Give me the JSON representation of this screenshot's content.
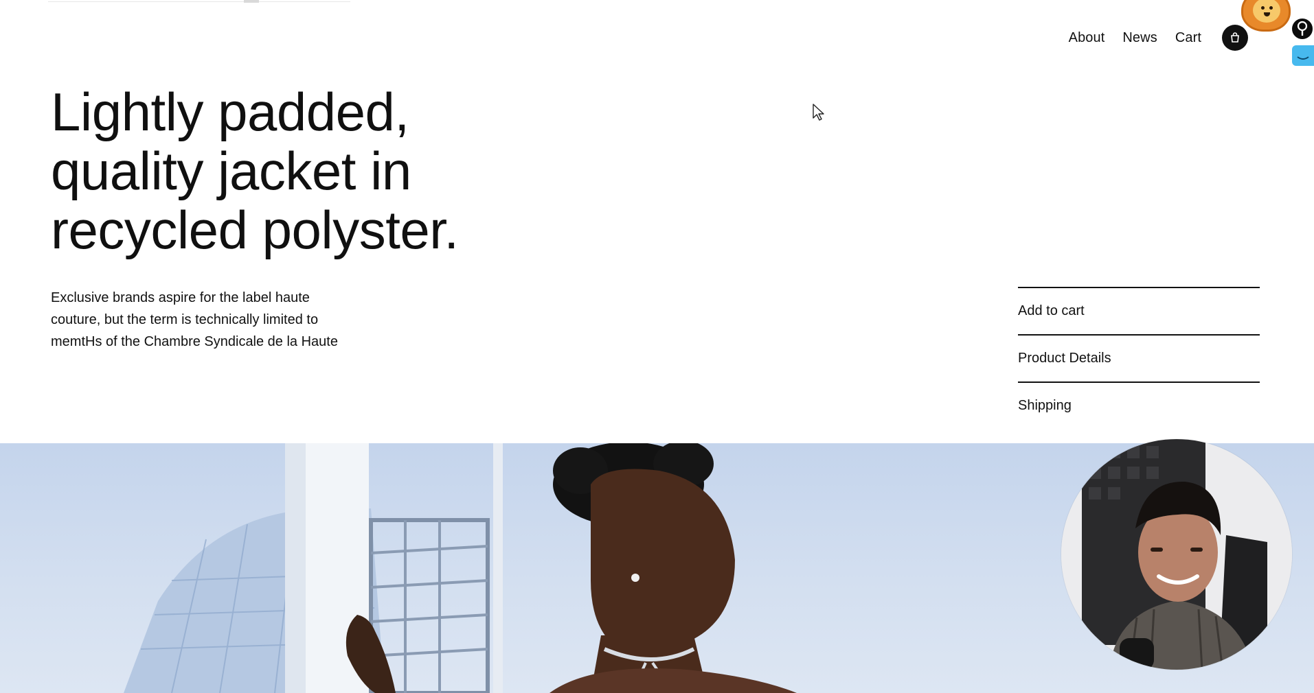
{
  "nav": {
    "items": [
      "About",
      "News",
      "Cart"
    ],
    "cart_icon": "shopping-bag-icon"
  },
  "hero": {
    "headline_lines": [
      "Lightly padded,",
      "quality jacket in",
      "recycled polyster."
    ],
    "description_lines": [
      "Exclusive brands aspire for the label haute",
      "couture, but the term is technically limited to",
      "memtHs of the Chambre Syndicale de la Haute"
    ]
  },
  "accordion": {
    "items": [
      "Add to cart",
      "Product Details",
      "Shipping"
    ]
  },
  "overlays": {
    "mascot_icon": "lion-mascot-icon",
    "key_icon": "key-icon",
    "side_tab_icon": "extension-tab-icon",
    "cursor_icon": "mouse-pointer-icon"
  },
  "colors": {
    "text": "#111111",
    "background": "#ffffff",
    "sky": "#c4d4ec",
    "extension_blue": "#47b9ee",
    "mascot_orange": "#e8892a"
  }
}
